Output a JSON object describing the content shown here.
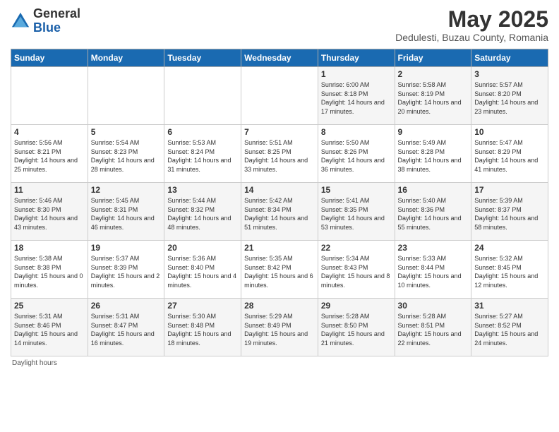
{
  "header": {
    "logo_general": "General",
    "logo_blue": "Blue",
    "month_title": "May 2025",
    "subtitle": "Dedulesti, Buzau County, Romania"
  },
  "days_of_week": [
    "Sunday",
    "Monday",
    "Tuesday",
    "Wednesday",
    "Thursday",
    "Friday",
    "Saturday"
  ],
  "weeks": [
    [
      {
        "day": "",
        "info": ""
      },
      {
        "day": "",
        "info": ""
      },
      {
        "day": "",
        "info": ""
      },
      {
        "day": "",
        "info": ""
      },
      {
        "day": "1",
        "info": "Sunrise: 6:00 AM\nSunset: 8:18 PM\nDaylight: 14 hours\nand 17 minutes."
      },
      {
        "day": "2",
        "info": "Sunrise: 5:58 AM\nSunset: 8:19 PM\nDaylight: 14 hours\nand 20 minutes."
      },
      {
        "day": "3",
        "info": "Sunrise: 5:57 AM\nSunset: 8:20 PM\nDaylight: 14 hours\nand 23 minutes."
      }
    ],
    [
      {
        "day": "4",
        "info": "Sunrise: 5:56 AM\nSunset: 8:21 PM\nDaylight: 14 hours\nand 25 minutes."
      },
      {
        "day": "5",
        "info": "Sunrise: 5:54 AM\nSunset: 8:23 PM\nDaylight: 14 hours\nand 28 minutes."
      },
      {
        "day": "6",
        "info": "Sunrise: 5:53 AM\nSunset: 8:24 PM\nDaylight: 14 hours\nand 31 minutes."
      },
      {
        "day": "7",
        "info": "Sunrise: 5:51 AM\nSunset: 8:25 PM\nDaylight: 14 hours\nand 33 minutes."
      },
      {
        "day": "8",
        "info": "Sunrise: 5:50 AM\nSunset: 8:26 PM\nDaylight: 14 hours\nand 36 minutes."
      },
      {
        "day": "9",
        "info": "Sunrise: 5:49 AM\nSunset: 8:28 PM\nDaylight: 14 hours\nand 38 minutes."
      },
      {
        "day": "10",
        "info": "Sunrise: 5:47 AM\nSunset: 8:29 PM\nDaylight: 14 hours\nand 41 minutes."
      }
    ],
    [
      {
        "day": "11",
        "info": "Sunrise: 5:46 AM\nSunset: 8:30 PM\nDaylight: 14 hours\nand 43 minutes."
      },
      {
        "day": "12",
        "info": "Sunrise: 5:45 AM\nSunset: 8:31 PM\nDaylight: 14 hours\nand 46 minutes."
      },
      {
        "day": "13",
        "info": "Sunrise: 5:44 AM\nSunset: 8:32 PM\nDaylight: 14 hours\nand 48 minutes."
      },
      {
        "day": "14",
        "info": "Sunrise: 5:42 AM\nSunset: 8:34 PM\nDaylight: 14 hours\nand 51 minutes."
      },
      {
        "day": "15",
        "info": "Sunrise: 5:41 AM\nSunset: 8:35 PM\nDaylight: 14 hours\nand 53 minutes."
      },
      {
        "day": "16",
        "info": "Sunrise: 5:40 AM\nSunset: 8:36 PM\nDaylight: 14 hours\nand 55 minutes."
      },
      {
        "day": "17",
        "info": "Sunrise: 5:39 AM\nSunset: 8:37 PM\nDaylight: 14 hours\nand 58 minutes."
      }
    ],
    [
      {
        "day": "18",
        "info": "Sunrise: 5:38 AM\nSunset: 8:38 PM\nDaylight: 15 hours\nand 0 minutes."
      },
      {
        "day": "19",
        "info": "Sunrise: 5:37 AM\nSunset: 8:39 PM\nDaylight: 15 hours\nand 2 minutes."
      },
      {
        "day": "20",
        "info": "Sunrise: 5:36 AM\nSunset: 8:40 PM\nDaylight: 15 hours\nand 4 minutes."
      },
      {
        "day": "21",
        "info": "Sunrise: 5:35 AM\nSunset: 8:42 PM\nDaylight: 15 hours\nand 6 minutes."
      },
      {
        "day": "22",
        "info": "Sunrise: 5:34 AM\nSunset: 8:43 PM\nDaylight: 15 hours\nand 8 minutes."
      },
      {
        "day": "23",
        "info": "Sunrise: 5:33 AM\nSunset: 8:44 PM\nDaylight: 15 hours\nand 10 minutes."
      },
      {
        "day": "24",
        "info": "Sunrise: 5:32 AM\nSunset: 8:45 PM\nDaylight: 15 hours\nand 12 minutes."
      }
    ],
    [
      {
        "day": "25",
        "info": "Sunrise: 5:31 AM\nSunset: 8:46 PM\nDaylight: 15 hours\nand 14 minutes."
      },
      {
        "day": "26",
        "info": "Sunrise: 5:31 AM\nSunset: 8:47 PM\nDaylight: 15 hours\nand 16 minutes."
      },
      {
        "day": "27",
        "info": "Sunrise: 5:30 AM\nSunset: 8:48 PM\nDaylight: 15 hours\nand 18 minutes."
      },
      {
        "day": "28",
        "info": "Sunrise: 5:29 AM\nSunset: 8:49 PM\nDaylight: 15 hours\nand 19 minutes."
      },
      {
        "day": "29",
        "info": "Sunrise: 5:28 AM\nSunset: 8:50 PM\nDaylight: 15 hours\nand 21 minutes."
      },
      {
        "day": "30",
        "info": "Sunrise: 5:28 AM\nSunset: 8:51 PM\nDaylight: 15 hours\nand 22 minutes."
      },
      {
        "day": "31",
        "info": "Sunrise: 5:27 AM\nSunset: 8:52 PM\nDaylight: 15 hours\nand 24 minutes."
      }
    ]
  ],
  "footer": {
    "note": "Daylight hours"
  }
}
